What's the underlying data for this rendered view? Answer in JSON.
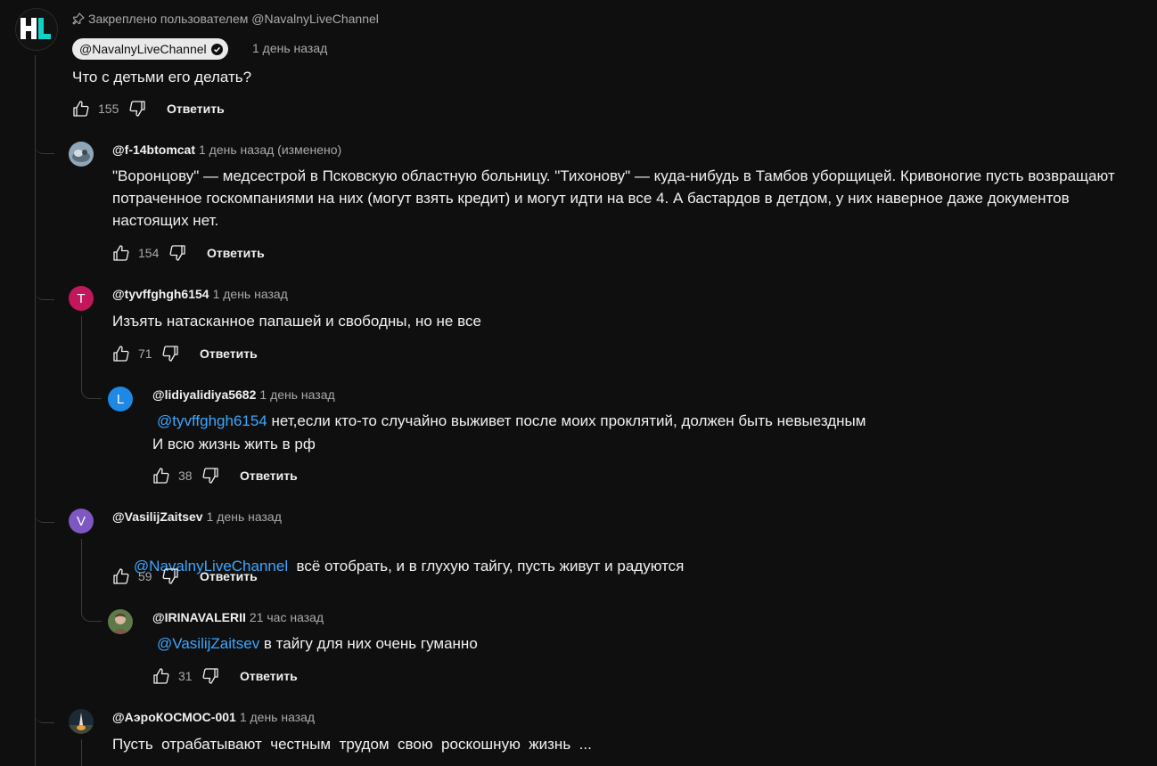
{
  "pinned": {
    "label": "Закреплено пользователем @NavalnyLiveChannel",
    "channel_logo": "HL",
    "author": "@NavalnyLiveChannel",
    "time": "1 день назад",
    "text": "Что с детьми его делать?",
    "likes": "155",
    "reply_label": "Ответить"
  },
  "replies": [
    {
      "author": "@f-14btomcat",
      "time": "1 день назад (изменено)",
      "lines": [
        "\"Воронцову\" — медсестрой в Псковскую областную больницу. \"Тихонову\" — куда-нибудь в Тамбов уборщицей. Кривоногие пусть возвращают",
        "потраченное госкомпаниями на них (могут взять кредит) и могут идти на все 4. А бастардов в детдом, у них наверное даже документов",
        "настоящих нет."
      ],
      "likes": "154",
      "reply_label": "Ответить"
    },
    {
      "author": "@tyvffghgh6154",
      "avatar_letter": "T",
      "time": "1 день назад",
      "text": "Изъять натасканное папашей и свободны, но не все",
      "likes": "71",
      "reply_label": "Ответить"
    },
    {
      "author": "@lidiyalidiya5682",
      "avatar_letter": "L",
      "time": "1 день назад",
      "mention": "@tyvffghgh6154",
      "text": " нет,если кто-то случайно выживет после моих проклятий, должен быть невыездным",
      "text2": "И всю жизнь жить в рф",
      "likes": "38",
      "reply_label": "Ответить"
    },
    {
      "author": "@VasilijZaitsev",
      "avatar_letter": "V",
      "time": "1 день назад",
      "mention": "@NavalnyLiveChannel",
      "text": "  всё отобрать, и в глухую тайгу, пусть живут и радуются",
      "likes": "59",
      "reply_label": "Ответить"
    },
    {
      "author": "@IRINAVALERII",
      "time": "21 час назад",
      "mention": "@VasilijZaitsev",
      "text": " в тайгу для них очень гуманно",
      "likes": "31",
      "reply_label": "Ответить"
    },
    {
      "author": "@АэроКОСМОС-001",
      "time": "1 день назад",
      "text": "Пусть  отрабатывают  честным  трудом  свою  роскошную  жизнь  ..."
    }
  ],
  "colors": {
    "background": "#0f0f0f",
    "link": "#3ea6ff",
    "avatar_t": "#c2185b",
    "avatar_l": "#1e88e5",
    "avatar_v": "#7e57c2"
  },
  "icons": [
    "pin-icon",
    "verified-icon",
    "like-icon",
    "dislike-icon"
  ]
}
